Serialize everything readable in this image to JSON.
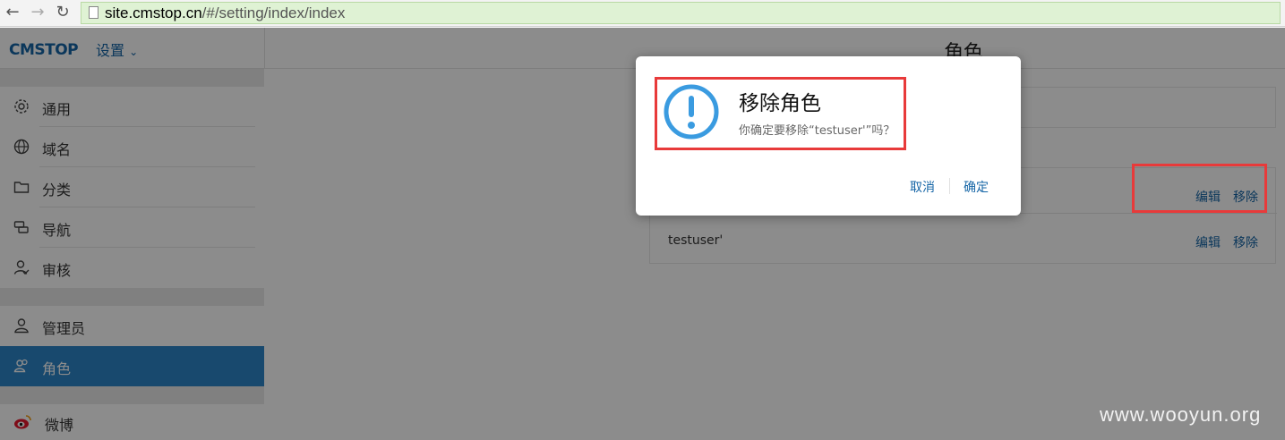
{
  "browser": {
    "url_host": "site.cmstop.cn",
    "url_path": "/#/setting/index/index"
  },
  "header": {
    "logo_text": "CMSTOP",
    "settings_label": "设置",
    "page_title": "角色"
  },
  "sidebar": {
    "items": [
      {
        "label": "通用",
        "icon": "gear-icon"
      },
      {
        "label": "域名",
        "icon": "globe-icon"
      },
      {
        "label": "分类",
        "icon": "folder-icon"
      },
      {
        "label": "导航",
        "icon": "nav-icon"
      },
      {
        "label": "审核",
        "icon": "audit-icon"
      },
      {
        "label": "管理员",
        "icon": "user-icon"
      },
      {
        "label": "角色",
        "icon": "users-icon",
        "active": true
      },
      {
        "label": "微博",
        "icon": "weibo-icon"
      }
    ]
  },
  "roles": {
    "rows": [
      {
        "name": "",
        "edit": "编辑",
        "remove": "移除"
      },
      {
        "name": "testuser'",
        "edit": "编辑",
        "remove": "移除"
      }
    ]
  },
  "dialog": {
    "title": "移除角色",
    "message": "你确定要移除“testuser'”吗？",
    "cancel": "取消",
    "confirm": "确定"
  },
  "watermark": "www.wooyun.org",
  "colors": {
    "accent": "#2c86c8",
    "link": "#1565a6",
    "highlight": "#e83a3a",
    "icon_blue": "#3a9be0"
  }
}
